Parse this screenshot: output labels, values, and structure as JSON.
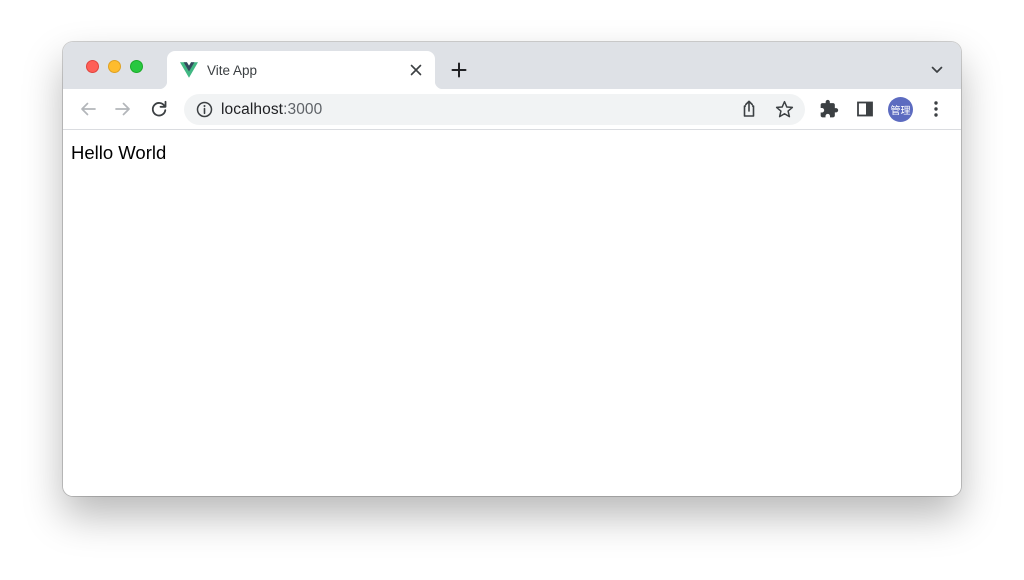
{
  "browser": {
    "tab": {
      "title": "Vite App",
      "favicon": "vue-logo-icon"
    },
    "address_bar": {
      "host": "localhost",
      "port": ":3000"
    },
    "profile": {
      "avatar_text": "管理",
      "color": "#5c6bc0"
    },
    "icons": [
      "back-icon",
      "forward-icon",
      "reload-icon",
      "info-icon",
      "share-icon",
      "star-icon",
      "extensions-icon",
      "side-panel-icon",
      "menu-icon",
      "close-icon",
      "plus-icon",
      "chevron-down-icon"
    ]
  },
  "page": {
    "body_text": "Hello World"
  },
  "colors": {
    "tabstrip": "#dee1e6",
    "traffic_red": "#fe5f57",
    "traffic_yellow": "#febc2e",
    "traffic_green": "#28c840",
    "vue_green": "#41b883",
    "vue_dark": "#35495e"
  }
}
